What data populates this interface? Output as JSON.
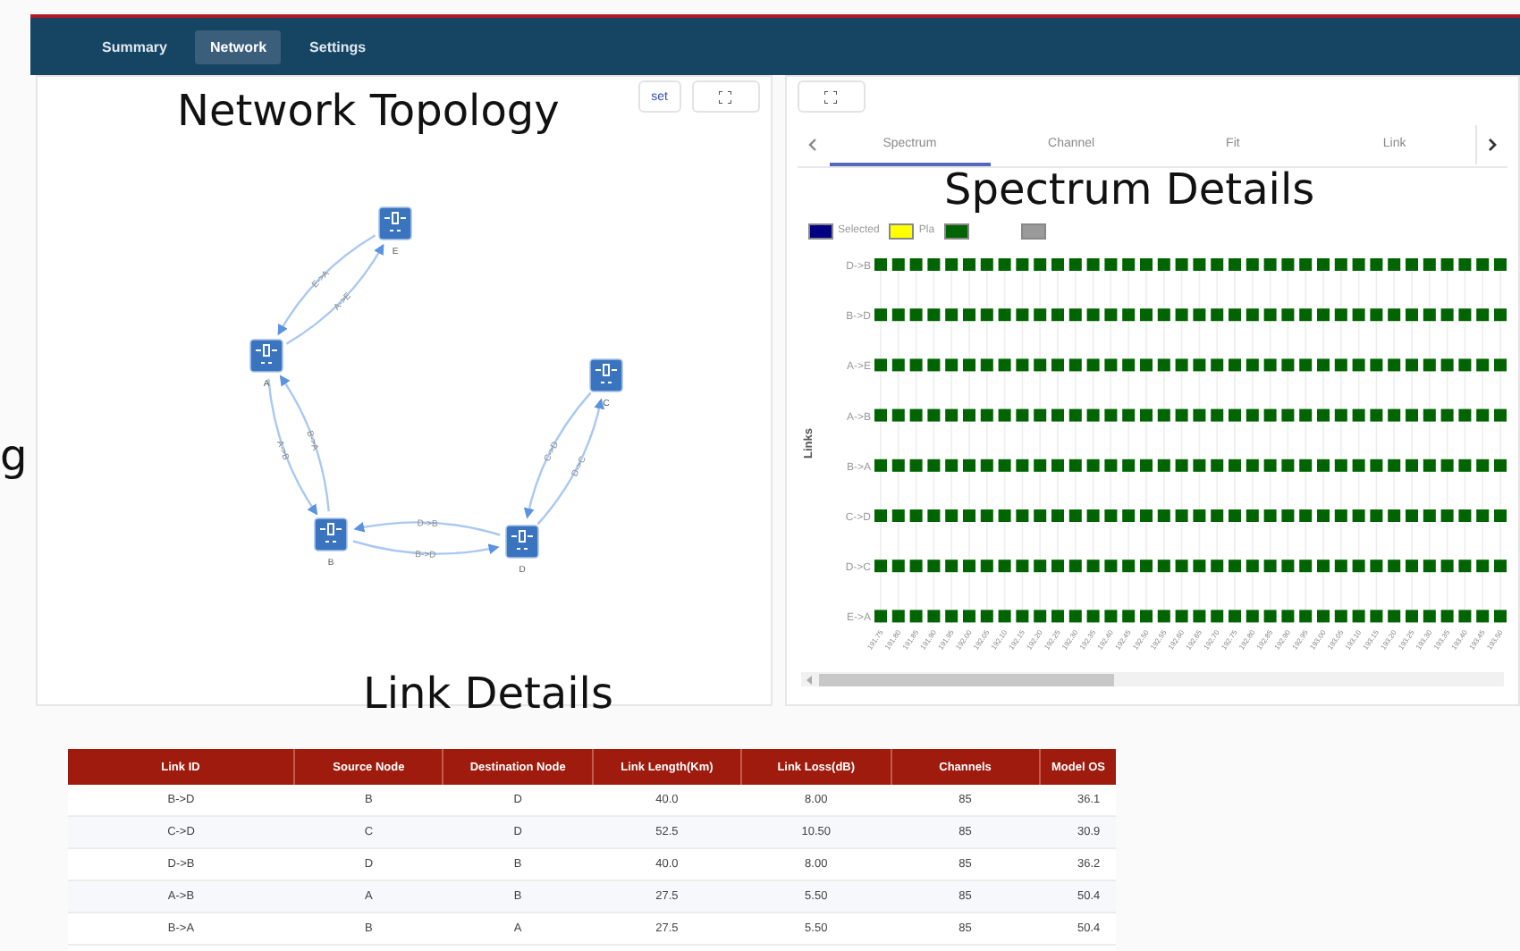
{
  "nav": {
    "tabs": [
      {
        "label": "Summary",
        "selected": false
      },
      {
        "label": "Network",
        "selected": true
      },
      {
        "label": "Settings",
        "selected": false
      }
    ]
  },
  "topology": {
    "buttons": [
      "set"
    ],
    "nodes": [
      {
        "name": "E"
      },
      {
        "name": "A"
      },
      {
        "name": "C"
      },
      {
        "name": "B"
      },
      {
        "name": "D"
      }
    ],
    "edges": [
      {
        "label": "E->A"
      },
      {
        "label": "A->E"
      },
      {
        "label": "A->B"
      },
      {
        "label": "B->A"
      },
      {
        "label": "D->B"
      },
      {
        "label": "B->D"
      },
      {
        "label": "C->D"
      },
      {
        "label": "D->C"
      }
    ]
  },
  "details": {
    "tabs": [
      {
        "label": "Spectrum",
        "selected": true
      },
      {
        "label": "Channel",
        "selected": false
      },
      {
        "label": "Fit",
        "selected": false
      },
      {
        "label": "Link",
        "selected": false
      }
    ],
    "legend": [
      {
        "label": "Selected",
        "color": "#000080"
      },
      {
        "label": "Pla",
        "color": "#ffff00"
      },
      {
        "color": "#006400"
      },
      {
        "color": "#9a9a9a"
      }
    ],
    "y_title": "Links",
    "rows": [
      {
        "link": "D->B",
        "kind": "deployed"
      },
      {
        "link": "B->D",
        "kind": "deployed"
      },
      {
        "link": "A->E",
        "kind": "deployed"
      },
      {
        "link": "A->B",
        "kind": "deployed"
      },
      {
        "link": "B->A",
        "kind": "deployed"
      },
      {
        "link": "C->D",
        "kind": "deployed"
      },
      {
        "link": "D->C",
        "kind": "deployed"
      },
      {
        "link": "E->A",
        "kind": "deployed"
      }
    ],
    "frequencies": [
      "191.75",
      "191.80",
      "191.85",
      "191.90",
      "191.95",
      "192.00",
      "192.05",
      "192.10",
      "192.15",
      "192.20",
      "192.25",
      "192.30",
      "192.35",
      "192.40",
      "192.45",
      "192.50",
      "192.55",
      "192.60",
      "192.65",
      "192.70",
      "192.75",
      "192.80",
      "192.85",
      "192.90",
      "192.95",
      "193.00",
      "193.05",
      "193.10",
      "193.15",
      "193.20",
      "193.25",
      "193.30",
      "193.35",
      "193.40",
      "193.45",
      "193.50"
    ]
  },
  "links_table": {
    "columns": [
      "Link ID",
      "Source Node",
      "Destination Node",
      "Link Length(Km)",
      "Link Loss(dB)",
      "Channels",
      "Model OS"
    ],
    "rows": [
      [
        "B->D",
        "B",
        "D",
        "40.0",
        "8.00",
        "85",
        "36.1"
      ],
      [
        "C->D",
        "C",
        "D",
        "52.5",
        "10.50",
        "85",
        "30.9"
      ],
      [
        "D->B",
        "D",
        "B",
        "40.0",
        "8.00",
        "85",
        "36.2"
      ],
      [
        "A->B",
        "A",
        "B",
        "27.5",
        "5.50",
        "85",
        "50.4"
      ],
      [
        "B->A",
        "B",
        "A",
        "27.5",
        "5.50",
        "85",
        "50.4"
      ]
    ]
  },
  "captions": [
    {
      "kind": "topology",
      "text": "Network Topology"
    },
    {
      "kind": "spectrum",
      "text": "Spectrum Details"
    },
    {
      "kind": "table",
      "text": "Link Details"
    },
    {
      "kind": "edge",
      "text": "g"
    }
  ]
}
